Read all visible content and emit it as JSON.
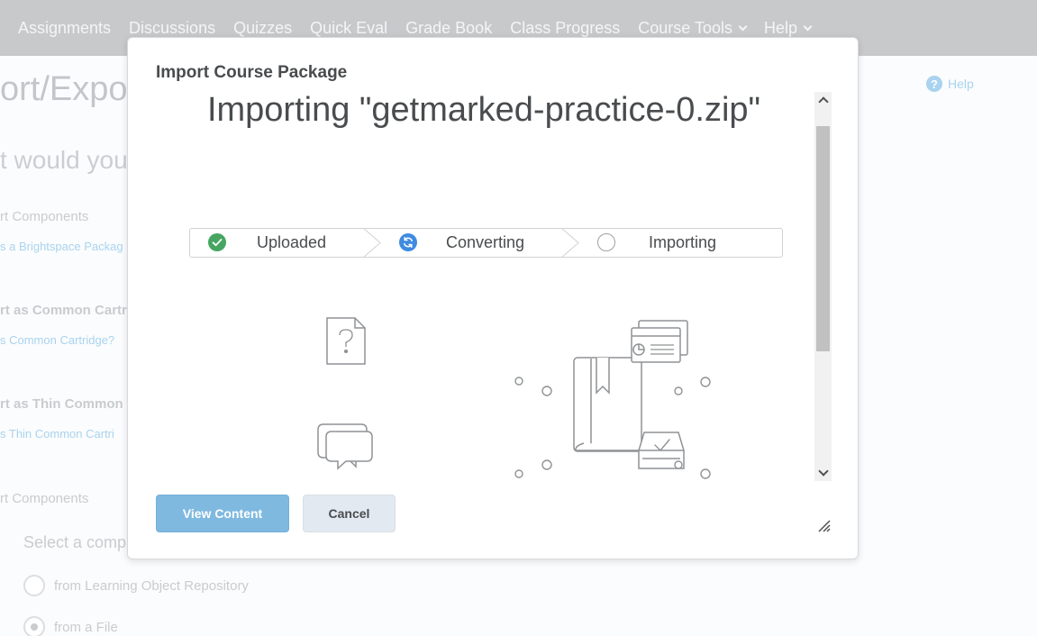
{
  "topnav": {
    "items": [
      {
        "label": "Assignments",
        "dropdown": false
      },
      {
        "label": "Discussions",
        "dropdown": false
      },
      {
        "label": "Quizzes",
        "dropdown": false
      },
      {
        "label": "Quick Eval",
        "dropdown": false
      },
      {
        "label": "Grade Book",
        "dropdown": false
      },
      {
        "label": "Class Progress",
        "dropdown": false
      },
      {
        "label": "Course Tools",
        "dropdown": true
      },
      {
        "label": "Help",
        "dropdown": true
      }
    ]
  },
  "background": {
    "page_title": "ort/Expo",
    "subtitle": "t would you",
    "help_label": "Help",
    "sections": [
      {
        "heading": "rt Components",
        "link": "s a Brightspace Packag"
      },
      {
        "heading": "rt as Common Cartr",
        "link": "s Common Cartridge?"
      },
      {
        "heading": "rt as Thin Common",
        "link": "s Thin Common Cartri"
      },
      {
        "heading": "rt Components"
      }
    ],
    "select_label": "Select a comp",
    "radio_options": [
      {
        "label": "from Learning Object Repository",
        "checked": false
      },
      {
        "label": "from a File",
        "checked": true
      }
    ]
  },
  "dialog": {
    "title": "Import Course Package",
    "heading": "Importing \"getmarked-practice-0.zip\"",
    "steps": [
      {
        "label": "Uploaded",
        "state": "done"
      },
      {
        "label": "Converting",
        "state": "active"
      },
      {
        "label": "Importing",
        "state": "pending"
      }
    ],
    "buttons": {
      "view_content": "View Content",
      "cancel": "Cancel"
    }
  },
  "colors": {
    "nav_bg": "#c8c9cb",
    "step_done": "#46a661",
    "step_active": "#3f8be0",
    "primary_button": "#7fb9e0",
    "link": "#a9d3ef"
  }
}
